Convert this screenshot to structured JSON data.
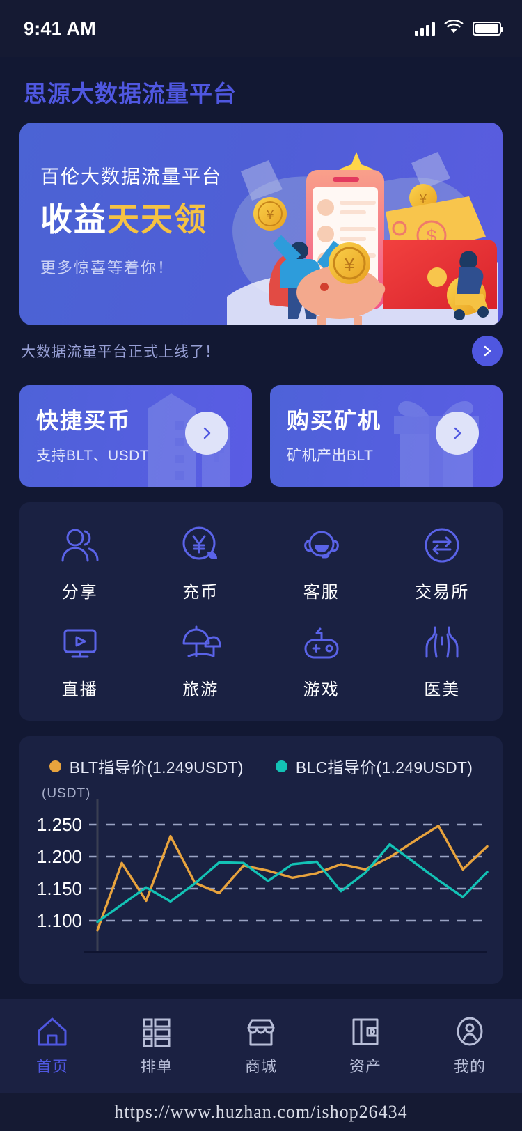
{
  "status_bar": {
    "time": "9:41 AM",
    "signal_icon": "cellular-bars-icon",
    "wifi_icon": "wifi-icon",
    "battery_icon": "battery-icon"
  },
  "header": {
    "app_title": "思源大数据流量平台",
    "title_color": "#4f57e0"
  },
  "banner": {
    "line1": "百伦大数据流量平台",
    "line2_white": "收益",
    "line2_gold": "天天领",
    "line3": "更多惊喜等着你！",
    "gold_color": "#f5c243",
    "bg_from": "#4b63d4",
    "bg_to": "#5a5ce0",
    "illustration": "finance-phone-piggybank-wallet-illustration"
  },
  "notice": {
    "text": "大数据流量平台正式上线了！",
    "arrow_icon": "chevron-right-icon",
    "accent": "#4f57e0"
  },
  "quick_cards": [
    {
      "title": "快捷买币",
      "subtitle": "支持BLT、USDT",
      "arrow_icon": "chevron-right-icon",
      "bg_icon": "building-icon",
      "name": "quick-buy-coin-card"
    },
    {
      "title": "购买矿机",
      "subtitle": "矿机产出BLT",
      "arrow_icon": "chevron-right-icon",
      "bg_icon": "gift-icon",
      "name": "buy-miner-card"
    }
  ],
  "shortcuts": [
    {
      "label": "分享",
      "icon": "users-icon"
    },
    {
      "label": "充币",
      "icon": "yen-coin-icon"
    },
    {
      "label": "客服",
      "icon": "headset-support-icon"
    },
    {
      "label": "交易所",
      "icon": "exchange-arrows-icon"
    },
    {
      "label": "直播",
      "icon": "live-monitor-play-icon"
    },
    {
      "label": "旅游",
      "icon": "beach-umbrella-icon"
    },
    {
      "label": "游戏",
      "icon": "gamepad-icon"
    },
    {
      "label": "医美",
      "icon": "body-torso-icon"
    }
  ],
  "chart_data": {
    "type": "line",
    "title": "",
    "xlabel": "",
    "ylabel": "(USDT)",
    "unit_label": "(USDT)",
    "ylim": [
      1.075,
      1.275
    ],
    "yticks": [
      1.25,
      1.2,
      1.15,
      1.1
    ],
    "ytick_labels": [
      "1.250",
      "1.200",
      "1.150",
      "1.100"
    ],
    "grid": true,
    "legend_position": "top-center",
    "x": [
      1,
      2,
      3,
      4,
      5,
      6,
      7,
      8,
      9,
      10,
      11,
      12,
      13,
      14,
      15,
      16,
      17
    ],
    "series": [
      {
        "name": "BLT指导价(1.249USDT)",
        "legend_label": "BLT指导价(1.249USDT)",
        "color": "#e8a33d",
        "values": [
          1.085,
          1.19,
          1.131,
          1.232,
          1.159,
          1.143,
          1.186,
          1.178,
          1.167,
          1.174,
          1.188,
          1.18,
          1.199,
          1.224,
          1.248,
          1.18,
          1.216
        ]
      },
      {
        "name": "BLC指导价(1.249USDT)",
        "legend_label": "BLC指导价(1.249USDT)",
        "color": "#13c2b5",
        "values": [
          1.098,
          1.125,
          1.152,
          1.13,
          1.158,
          1.191,
          1.19,
          1.162,
          1.188,
          1.192,
          1.146,
          1.175,
          1.219,
          1.191,
          1.163,
          1.137,
          1.176
        ]
      }
    ]
  },
  "tabs": [
    {
      "label": "首页",
      "icon": "home-icon",
      "active": true
    },
    {
      "label": "排单",
      "icon": "list-grid-icon",
      "active": false
    },
    {
      "label": "商城",
      "icon": "shop-icon",
      "active": false
    },
    {
      "label": "资产",
      "icon": "wallet-icon",
      "active": false
    },
    {
      "label": "我的",
      "icon": "person-icon",
      "active": false
    }
  ],
  "watermark": {
    "url": "https://www.huzhan.com/ishop26434"
  }
}
